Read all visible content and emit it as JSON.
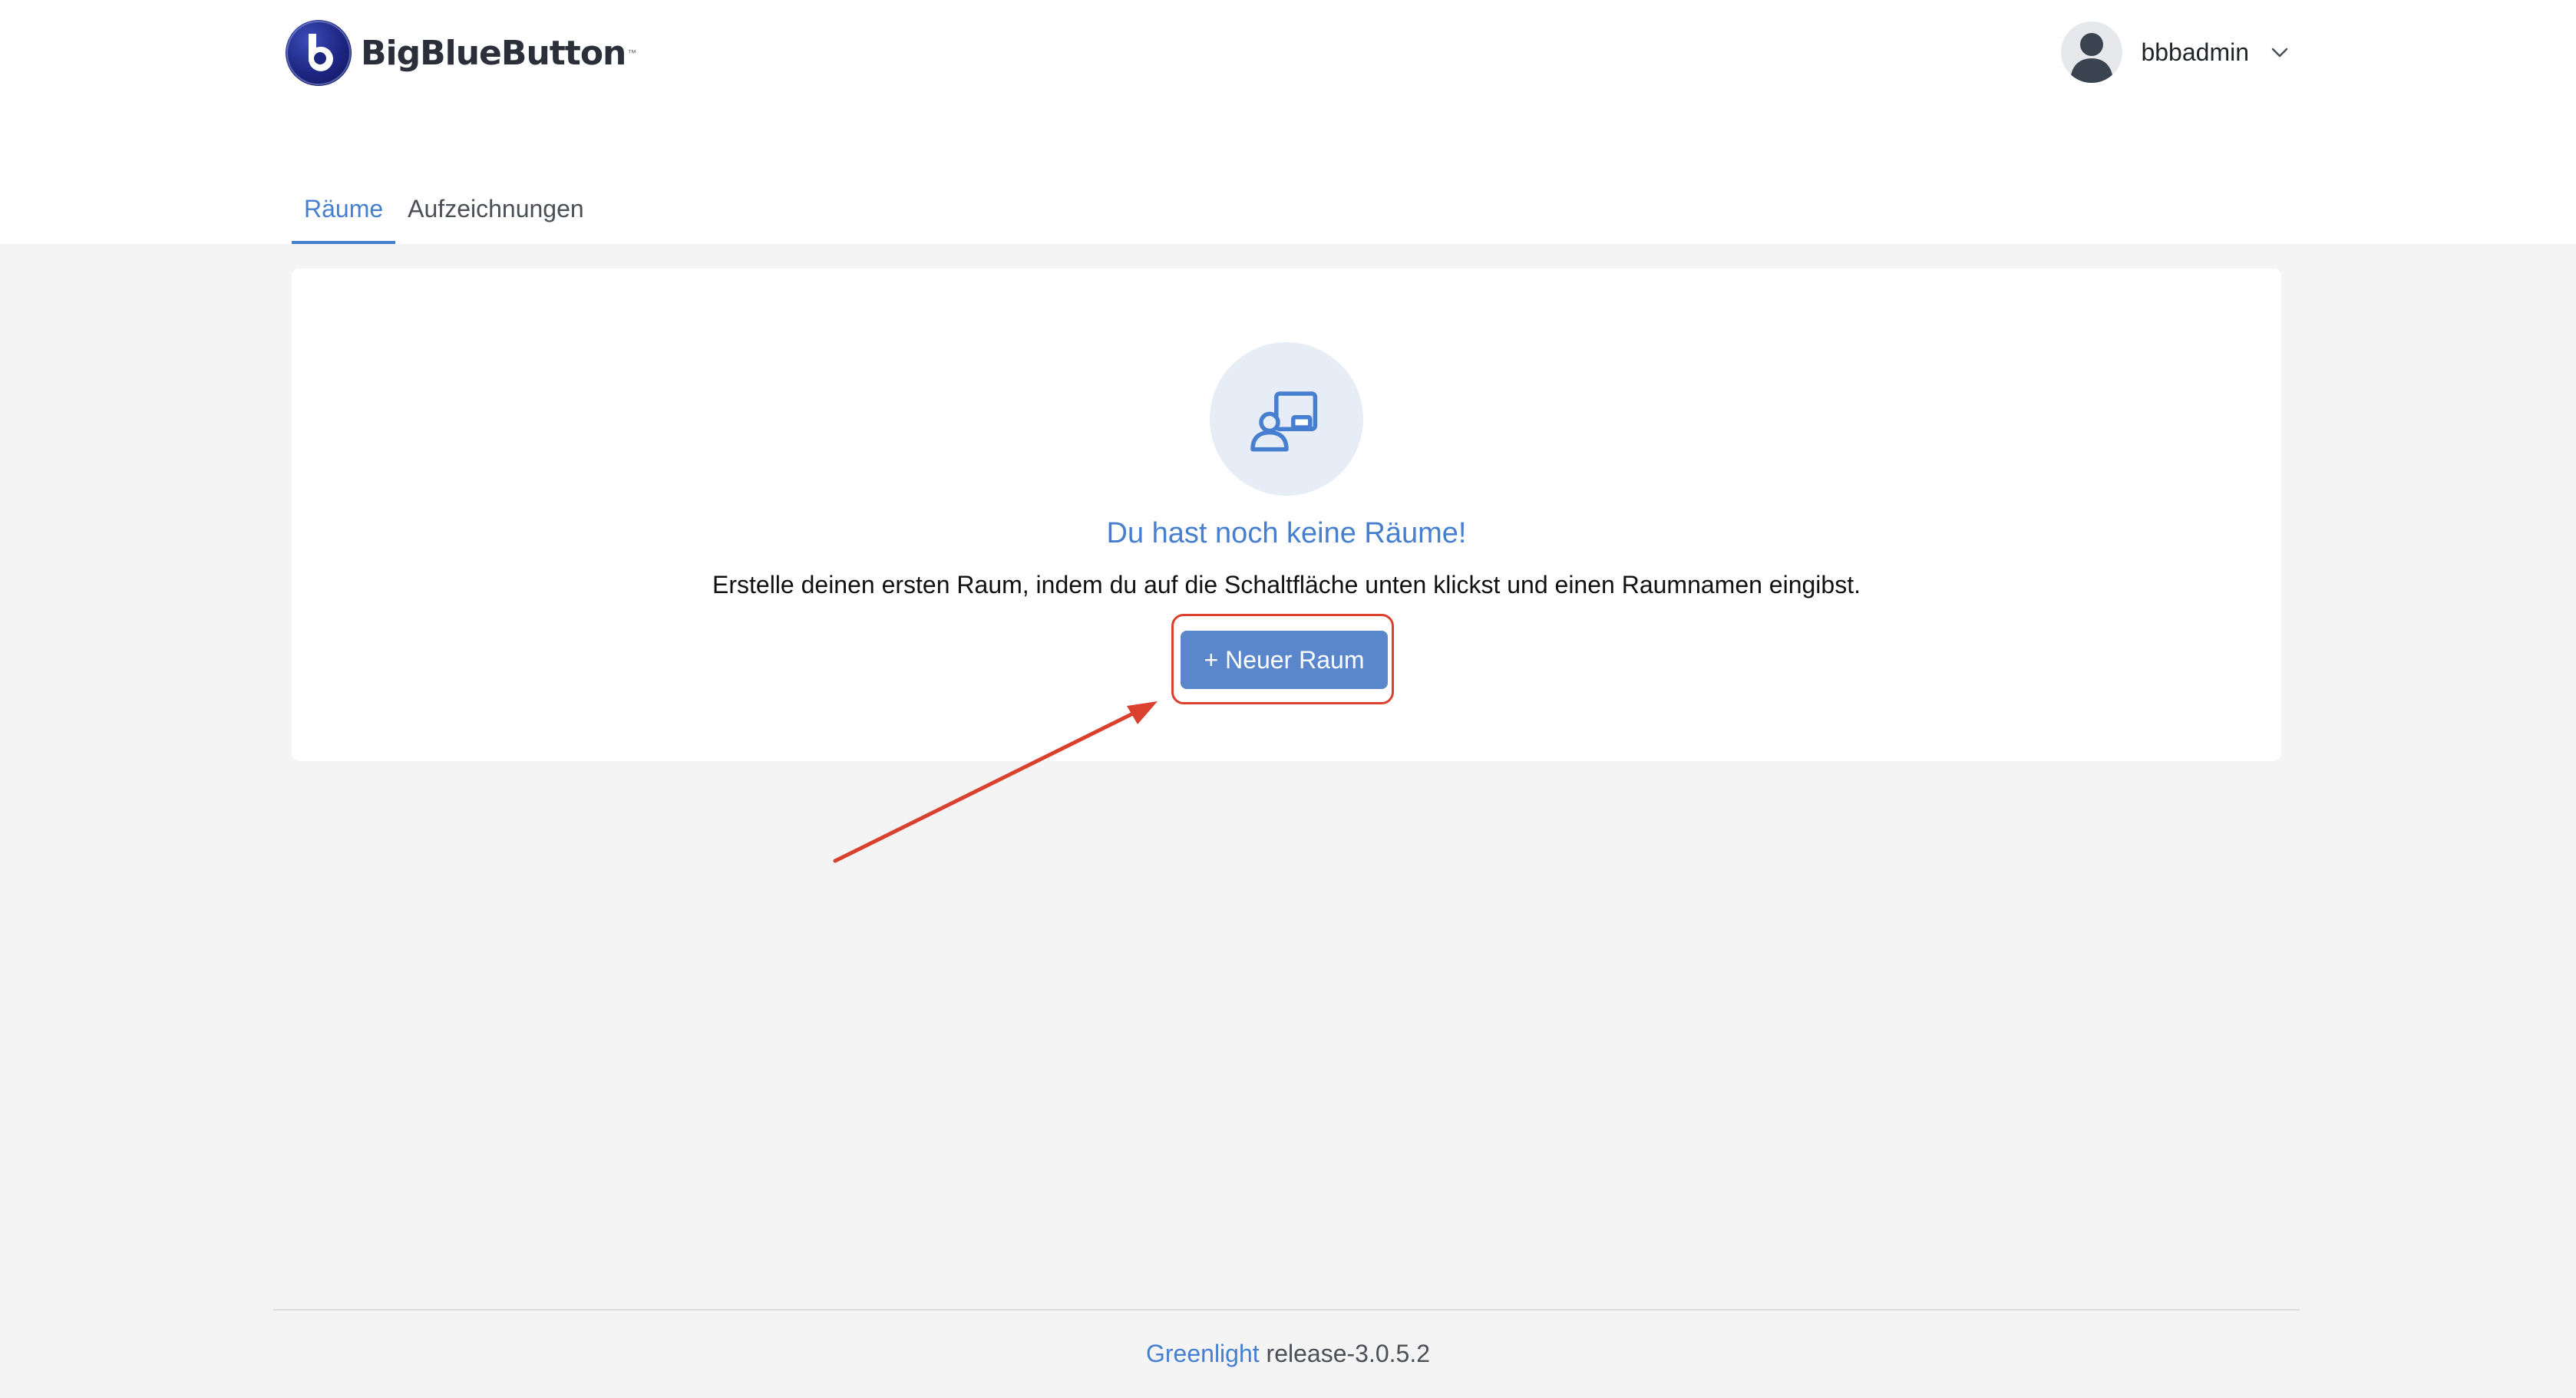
{
  "header": {
    "logo_text": "BigBlueButton",
    "logo_tm": "™",
    "user": {
      "name": "bbbadmin",
      "avatar_icon": "user-avatar-icon",
      "menu_icon": "chevron-down-icon"
    }
  },
  "tabs": [
    {
      "label": "Räume",
      "active": true
    },
    {
      "label": "Aufzeichnungen",
      "active": false
    }
  ],
  "empty_state": {
    "icon": "room-presentation-icon",
    "title": "Du hast noch keine Räume!",
    "description": "Erstelle deinen ersten Raum, indem du auf die Schaltfläche unten klickst und einen Raumnamen eingibst.",
    "button_label": "+ Neuer Raum"
  },
  "footer": {
    "brand": "Greenlight",
    "version": "release-3.0.5.2"
  },
  "colors": {
    "accent": "#467fcf",
    "button": "#5a86cc",
    "annotation": "#d9412e",
    "background": "#f4f4f4"
  }
}
